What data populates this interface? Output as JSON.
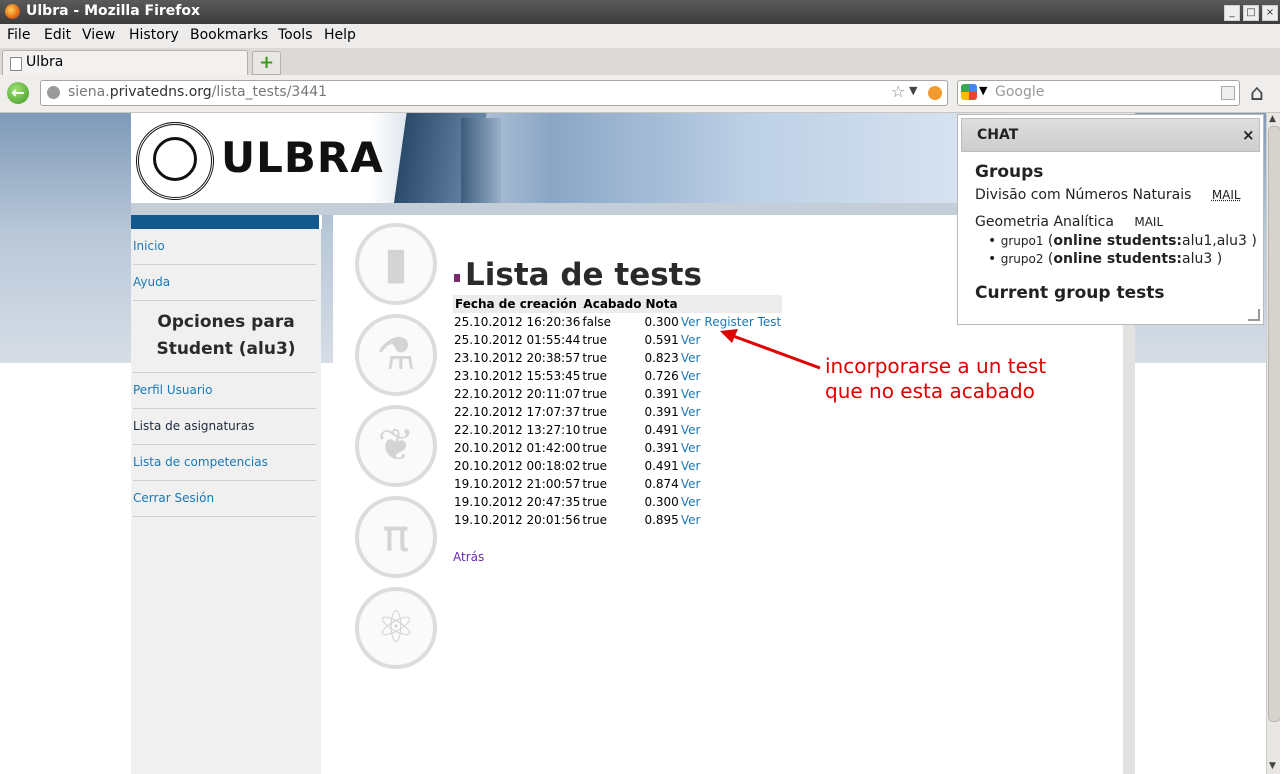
{
  "window": {
    "title": "Ulbra - Mozilla Firefox"
  },
  "menu": [
    {
      "label": "File"
    },
    {
      "label": "Edit"
    },
    {
      "label": "View"
    },
    {
      "label": "History"
    },
    {
      "label": "Bookmarks"
    },
    {
      "label": "Tools"
    },
    {
      "label": "Help"
    }
  ],
  "tab": {
    "label": "Ulbra",
    "new_tab_icon": "+"
  },
  "nav": {
    "url_host_prefix": "siena.",
    "url_host": "privatedns.org",
    "url_path": "/lista_tests/3441",
    "search_placeholder": "Google"
  },
  "site": {
    "brand": "ULBRA"
  },
  "sidebar": {
    "items": [
      {
        "label": "Inicio"
      },
      {
        "label": "Ayuda"
      },
      {
        "label": "Perfil Usuario"
      },
      {
        "label": "Lista de asignaturas"
      },
      {
        "label": "Lista de competencias"
      },
      {
        "label": "Cerrar Sesión"
      }
    ],
    "section_line1": "Opciones para",
    "section_line2": "Student (alu3)"
  },
  "main": {
    "title": "Lista de tests",
    "columns": [
      "Fecha de creación",
      "Acabado",
      "Nota"
    ],
    "rows": [
      {
        "fecha": "25.10.2012 16:20:36",
        "acabado": "false",
        "nota": "0.300",
        "ver": "Ver",
        "extra": "Register Test"
      },
      {
        "fecha": "25.10.2012 01:55:44",
        "acabado": "true",
        "nota": "0.591",
        "ver": "Ver"
      },
      {
        "fecha": "23.10.2012 20:38:57",
        "acabado": "true",
        "nota": "0.823",
        "ver": "Ver"
      },
      {
        "fecha": "23.10.2012 15:53:45",
        "acabado": "true",
        "nota": "0.726",
        "ver": "Ver"
      },
      {
        "fecha": "22.10.2012 20:11:07",
        "acabado": "true",
        "nota": "0.391",
        "ver": "Ver"
      },
      {
        "fecha": "22.10.2012 17:07:37",
        "acabado": "true",
        "nota": "0.391",
        "ver": "Ver"
      },
      {
        "fecha": "22.10.2012 13:27:10",
        "acabado": "true",
        "nota": "0.491",
        "ver": "Ver"
      },
      {
        "fecha": "20.10.2012 01:42:00",
        "acabado": "true",
        "nota": "0.391",
        "ver": "Ver"
      },
      {
        "fecha": "20.10.2012 00:18:02",
        "acabado": "true",
        "nota": "0.491",
        "ver": "Ver"
      },
      {
        "fecha": "19.10.2012 21:00:57",
        "acabado": "true",
        "nota": "0.874",
        "ver": "Ver"
      },
      {
        "fecha": "19.10.2012 20:47:35",
        "acabado": "true",
        "nota": "0.300",
        "ver": "Ver"
      },
      {
        "fecha": "19.10.2012 20:01:56",
        "acabado": "true",
        "nota": "0.895",
        "ver": "Ver"
      }
    ],
    "back_link": "Atrás"
  },
  "annotation": {
    "line1": "incorporarse a un test",
    "line2": "que no esta acabado",
    "color": "#e00000"
  },
  "chat": {
    "header": "CHAT",
    "close": "×",
    "groups_title": "Groups",
    "group1": "Divisão com Números Naturais",
    "group2": "Geometria Analítica",
    "mail_label": "MAIL",
    "subgroups": [
      {
        "name": "grupo1",
        "status_label": "online students:",
        "students": "alu1,alu3"
      },
      {
        "name": "grupo2",
        "status_label": "online students:",
        "students": "alu3"
      }
    ],
    "current_tests_title": "Current group tests"
  },
  "colors": {
    "link": "#1b78b5",
    "sidebar_band": "#13598e",
    "visited": "#6a2ab0"
  }
}
